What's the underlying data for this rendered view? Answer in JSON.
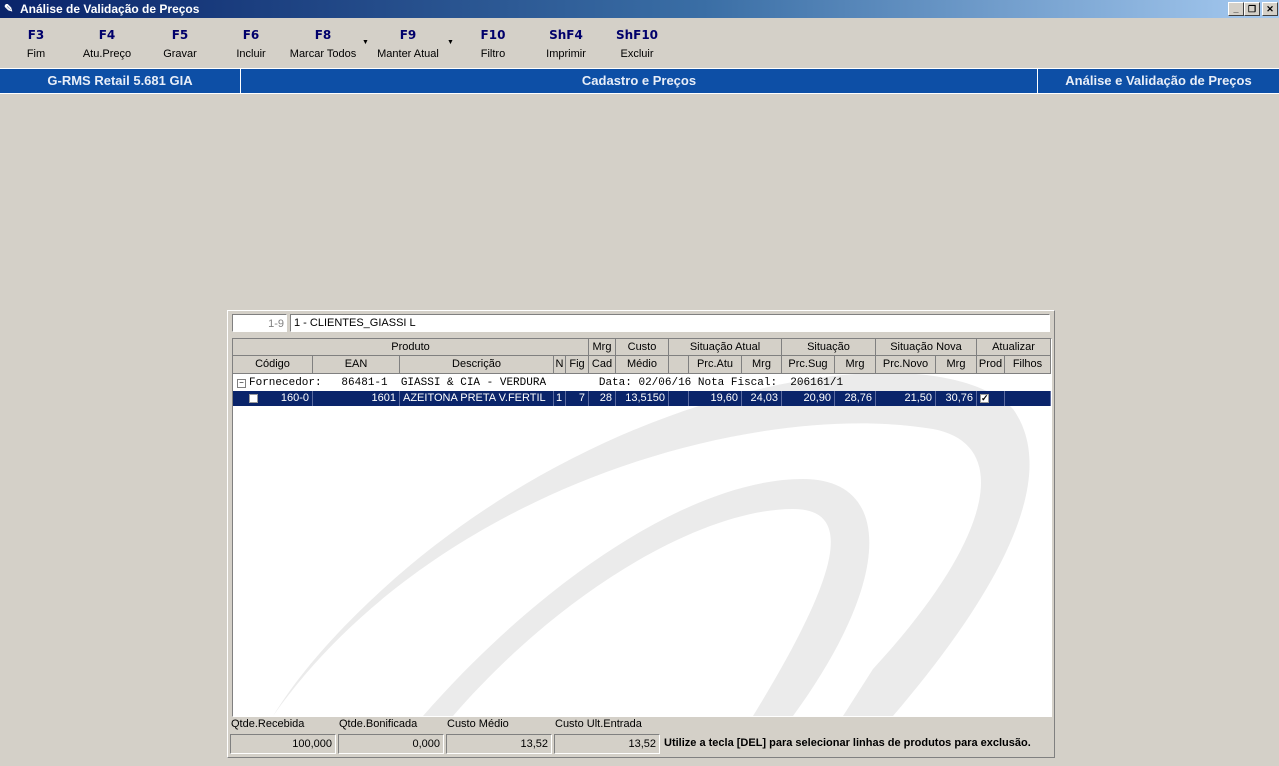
{
  "window": {
    "title": "Análise de Validação de Preços",
    "min": "_",
    "max": "❐",
    "close": "✕"
  },
  "toolbar": [
    {
      "key": "F3",
      "label": "Fim"
    },
    {
      "key": "F4",
      "label": "Atu.Preço"
    },
    {
      "key": "F5",
      "label": "Gravar"
    },
    {
      "key": "F6",
      "label": "Incluir"
    },
    {
      "key": "F8",
      "label": "Marcar Todos"
    },
    {
      "key": "F9",
      "label": "Manter Atual"
    },
    {
      "key": "F10",
      "label": "Filtro"
    },
    {
      "key": "ShF4",
      "label": "Imprimir"
    },
    {
      "key": "ShF10",
      "label": "Excluir"
    }
  ],
  "bluebar": {
    "system": "G-RMS Retail 5.681 GIA",
    "module": "Cadastro e Preços",
    "screen": "Análise e Validação de Preços"
  },
  "filter": {
    "range": "1-9",
    "store": "1 - CLIENTES_GIASSI L"
  },
  "grid": {
    "group_headers": {
      "produto": "Produto",
      "mrg": "Mrg",
      "custo": "Custo",
      "sit_atual": "Situação Atual",
      "situacao": "Situação",
      "sit_nova": "Situação Nova",
      "atualizar": "Atualizar"
    },
    "columns": {
      "codigo": "Código",
      "ean": "EAN",
      "descricao": "Descrição",
      "n": "N",
      "fig": "Fig",
      "cad": "Cad",
      "medio": "Médio",
      "prc_atu": "Prc.Atu",
      "mrg1": "Mrg",
      "prc_sug": "Prc.Sug",
      "mrg2": "Mrg",
      "prc_novo": "Prc.Novo",
      "mrg3": "Mrg",
      "prod": "Prod",
      "filhos": "Filhos"
    },
    "group": {
      "expander": "−",
      "text": "Fornecedor:   86481-1  GIASSI & CIA - VERDURA        Data: 02/06/16 Nota Fiscal:  206161/1"
    },
    "row": {
      "codigo": "160-0",
      "ean": "1601",
      "descricao": "AZEITONA PRETA V.FERTIL",
      "n": "1",
      "fig": "7",
      "cad": "28",
      "medio": "13,5150",
      "prc_atu": "19,60",
      "mrg1": "24,03",
      "prc_sug": "20,90",
      "mrg2": "28,76",
      "prc_novo": "21,50",
      "mrg3": "30,76",
      "prod_check": "✓"
    }
  },
  "footer": {
    "qtde_recebida_label": "Qtde.Recebida",
    "qtde_recebida": "100,000",
    "qtde_bonificada_label": "Qtde.Bonificada",
    "qtde_bonificada": "0,000",
    "custo_medio_label": "Custo Médio",
    "custo_medio": "13,52",
    "custo_ult_label": "Custo Ult.Entrada",
    "custo_ult": "13,52",
    "hint": "Utilize a tecla [DEL] para selecionar linhas de produtos para exclusão."
  }
}
